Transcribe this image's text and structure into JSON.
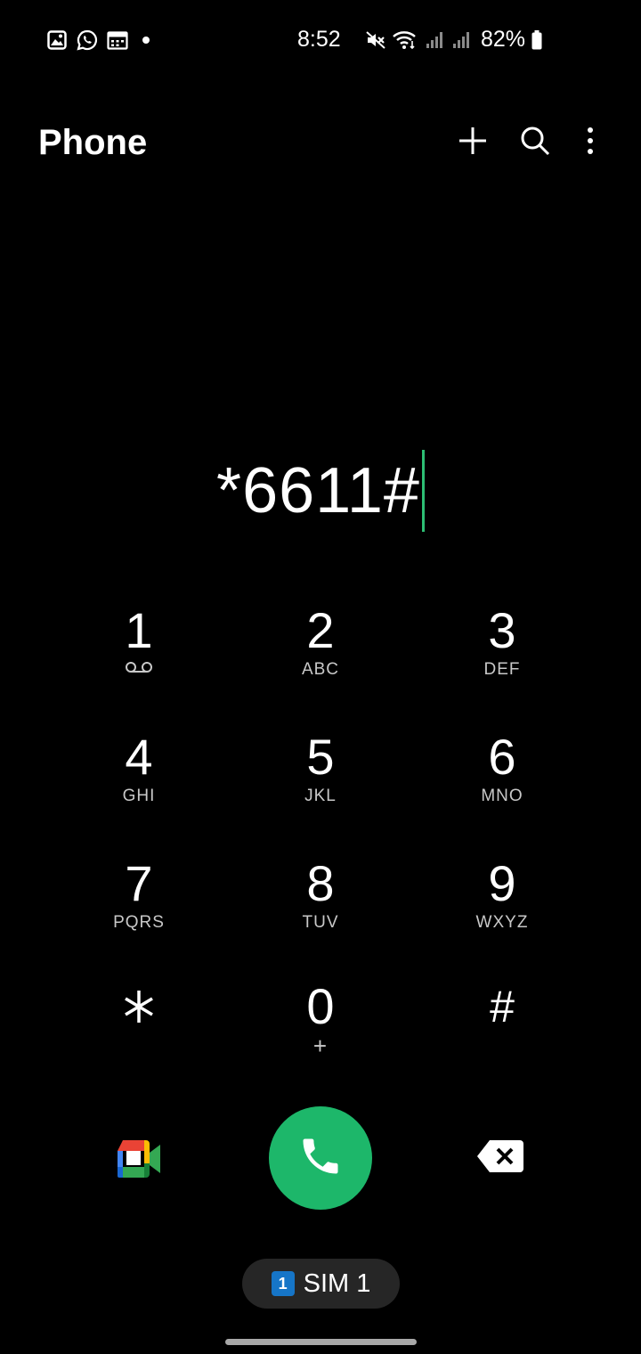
{
  "status_bar": {
    "time": "8:52",
    "battery": "82%",
    "icons": [
      "gallery-icon",
      "whatsapp-icon",
      "calendar-icon",
      "notification-dot",
      "mute-icon",
      "wifi-icon",
      "signal-icon",
      "signal-icon",
      "battery-icon"
    ]
  },
  "header": {
    "title": "Phone",
    "actions": [
      "add-icon",
      "search-icon",
      "more-options-icon"
    ]
  },
  "dialer": {
    "number": "*6611#",
    "accent_color": "#2dbe74"
  },
  "keypad": [
    {
      "digit": "1",
      "letters": "",
      "sub_icon": "voicemail-icon"
    },
    {
      "digit": "2",
      "letters": "ABC"
    },
    {
      "digit": "3",
      "letters": "DEF"
    },
    {
      "digit": "4",
      "letters": "GHI"
    },
    {
      "digit": "5",
      "letters": "JKL"
    },
    {
      "digit": "6",
      "letters": "MNO"
    },
    {
      "digit": "7",
      "letters": "PQRS"
    },
    {
      "digit": "8",
      "letters": "TUV"
    },
    {
      "digit": "9",
      "letters": "WXYZ"
    },
    {
      "digit": "*",
      "letters": ""
    },
    {
      "digit": "0",
      "letters": "+"
    },
    {
      "digit": "#",
      "letters": ""
    }
  ],
  "actions": {
    "video_call_icon": "google-meet-icon",
    "call_icon": "phone-icon",
    "call_color": "#1db76a",
    "backspace_icon": "backspace-icon"
  },
  "sim": {
    "badge": "1",
    "label": "SIM 1",
    "badge_color": "#1675c7"
  }
}
